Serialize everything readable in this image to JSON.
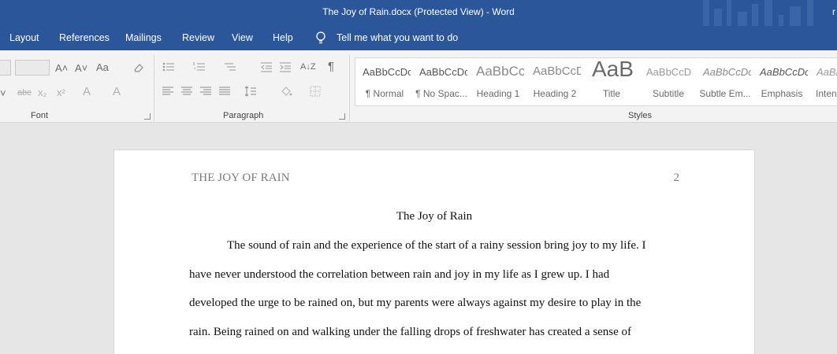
{
  "window": {
    "title": "The Joy of Rain.docx (Protected View)  -  Word",
    "user_initial": "r"
  },
  "menu": {
    "tabs": [
      "Layout",
      "References",
      "Mailings",
      "Review",
      "View",
      "Help"
    ],
    "tell_me": "Tell me what you want to do"
  },
  "ribbon": {
    "groups": {
      "font": "Font",
      "paragraph": "Paragraph",
      "styles": "Styles"
    },
    "styles": [
      {
        "preview": "AaBbCcDc",
        "name": "¶ Normal"
      },
      {
        "preview": "AaBbCcDc",
        "name": "¶ No Spac..."
      },
      {
        "preview": "AaBbCc",
        "name": "Heading 1"
      },
      {
        "preview": "AaBbCcD",
        "name": "Heading 2"
      },
      {
        "preview": "AaB",
        "name": "Title"
      },
      {
        "preview": "AaBbCcD",
        "name": "Subtitle"
      },
      {
        "preview": "AaBbCcDc",
        "name": "Subtle Em..."
      },
      {
        "preview": "AaBbCcDc",
        "name": "Emphasis"
      },
      {
        "preview": "AaBbCcDc",
        "name": "Intense..."
      }
    ],
    "icons": {
      "grow_font": "A˄",
      "shrink_font": "A˅",
      "change_case": "Aa",
      "clear_formatting": "eraser-icon",
      "strikethrough": "abc",
      "subscript": "x₂",
      "superscript": "x²",
      "text_effects": "A",
      "font_color": "A",
      "pilcrow": "¶",
      "sort": "A↓Z"
    }
  },
  "document": {
    "header_left": "THE JOY OF RAIN",
    "page_number": "2",
    "title": "The Joy of Rain",
    "lines": [
      "The sound of rain and the experience of the start of a rainy session bring joy to my life. I",
      "have never understood the correlation between rain and joy in my life as I grew up. I had",
      "developed the urge to be rained on, but my parents were always against my desire to play in the",
      "rain. Being rained on and walking under the falling drops of freshwater has created a sense of"
    ]
  }
}
